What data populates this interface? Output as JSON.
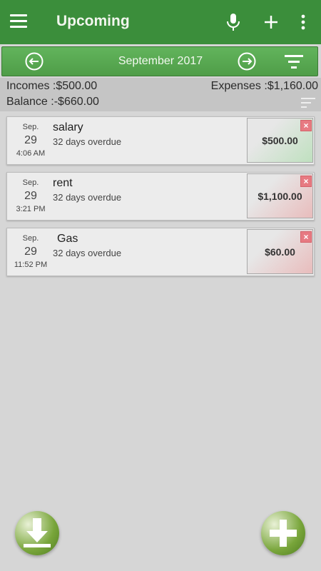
{
  "appbar": {
    "title": "Upcoming",
    "icons": [
      "menu-icon",
      "microphone-icon",
      "plus-icon",
      "more-icon"
    ]
  },
  "month_nav": {
    "label": "September 2017"
  },
  "summary": {
    "incomes": "Incomes :$500.00",
    "expenses": "Expenses :$1,160.00",
    "balance": "Balance :-$660.00"
  },
  "items": [
    {
      "month": "Sep.",
      "day": "29",
      "time": "4:06 AM",
      "name": "salary",
      "status": "32 days overdue",
      "amount": "$500.00",
      "type": "income"
    },
    {
      "month": "Sep.",
      "day": "29",
      "time": "3:21 PM",
      "name": "rent",
      "status": "32 days overdue",
      "amount": "$1,100.00",
      "type": "expense"
    },
    {
      "month": "Sep.",
      "day": "29",
      "time": "11:52 PM",
      "name": "Gas",
      "status": "32 days overdue",
      "amount": "$60.00",
      "type": "expense"
    }
  ],
  "colors": {
    "primary": "#3b8e3b",
    "income_tint": "#bfe0bf",
    "expense_tint": "#e8bcbc",
    "delete": "#e77a82"
  }
}
